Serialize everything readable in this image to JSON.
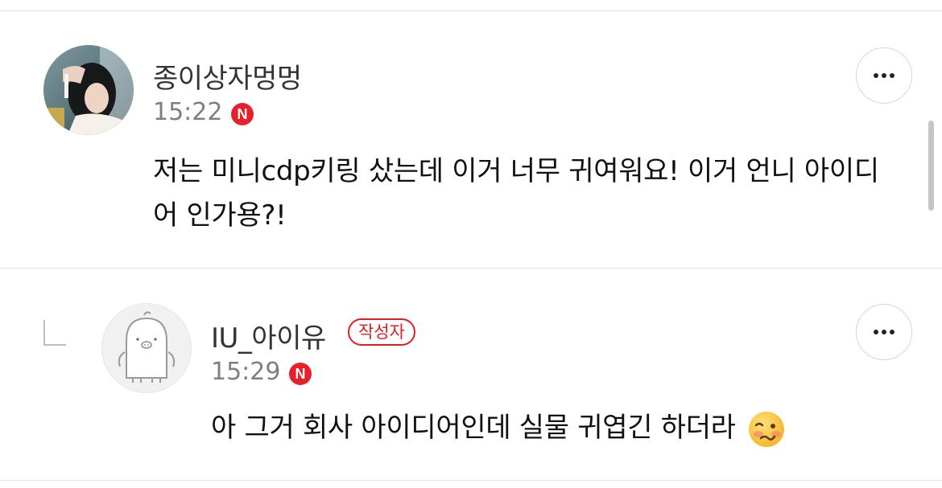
{
  "comments": [
    {
      "author": "종이상자멍멍",
      "time": "15:22",
      "badge": "N",
      "text": "저는 미니cdp키링 샀는데 이거 너무 귀여워요! 이거 언니 아이디어 인가용?!"
    }
  ],
  "reply": {
    "author": "IU_아이유",
    "writer_badge": "작성자",
    "time": "15:29",
    "badge": "N",
    "text": "아 그거 회사 아이디어인데 실물 귀엽긴 하더라",
    "emoji": "woozy-face"
  },
  "colors": {
    "badge_red": "#e8202a",
    "writer_badge_red": "#e02020",
    "time_gray": "#7f7f7f",
    "divider": "#e3e3e3"
  }
}
